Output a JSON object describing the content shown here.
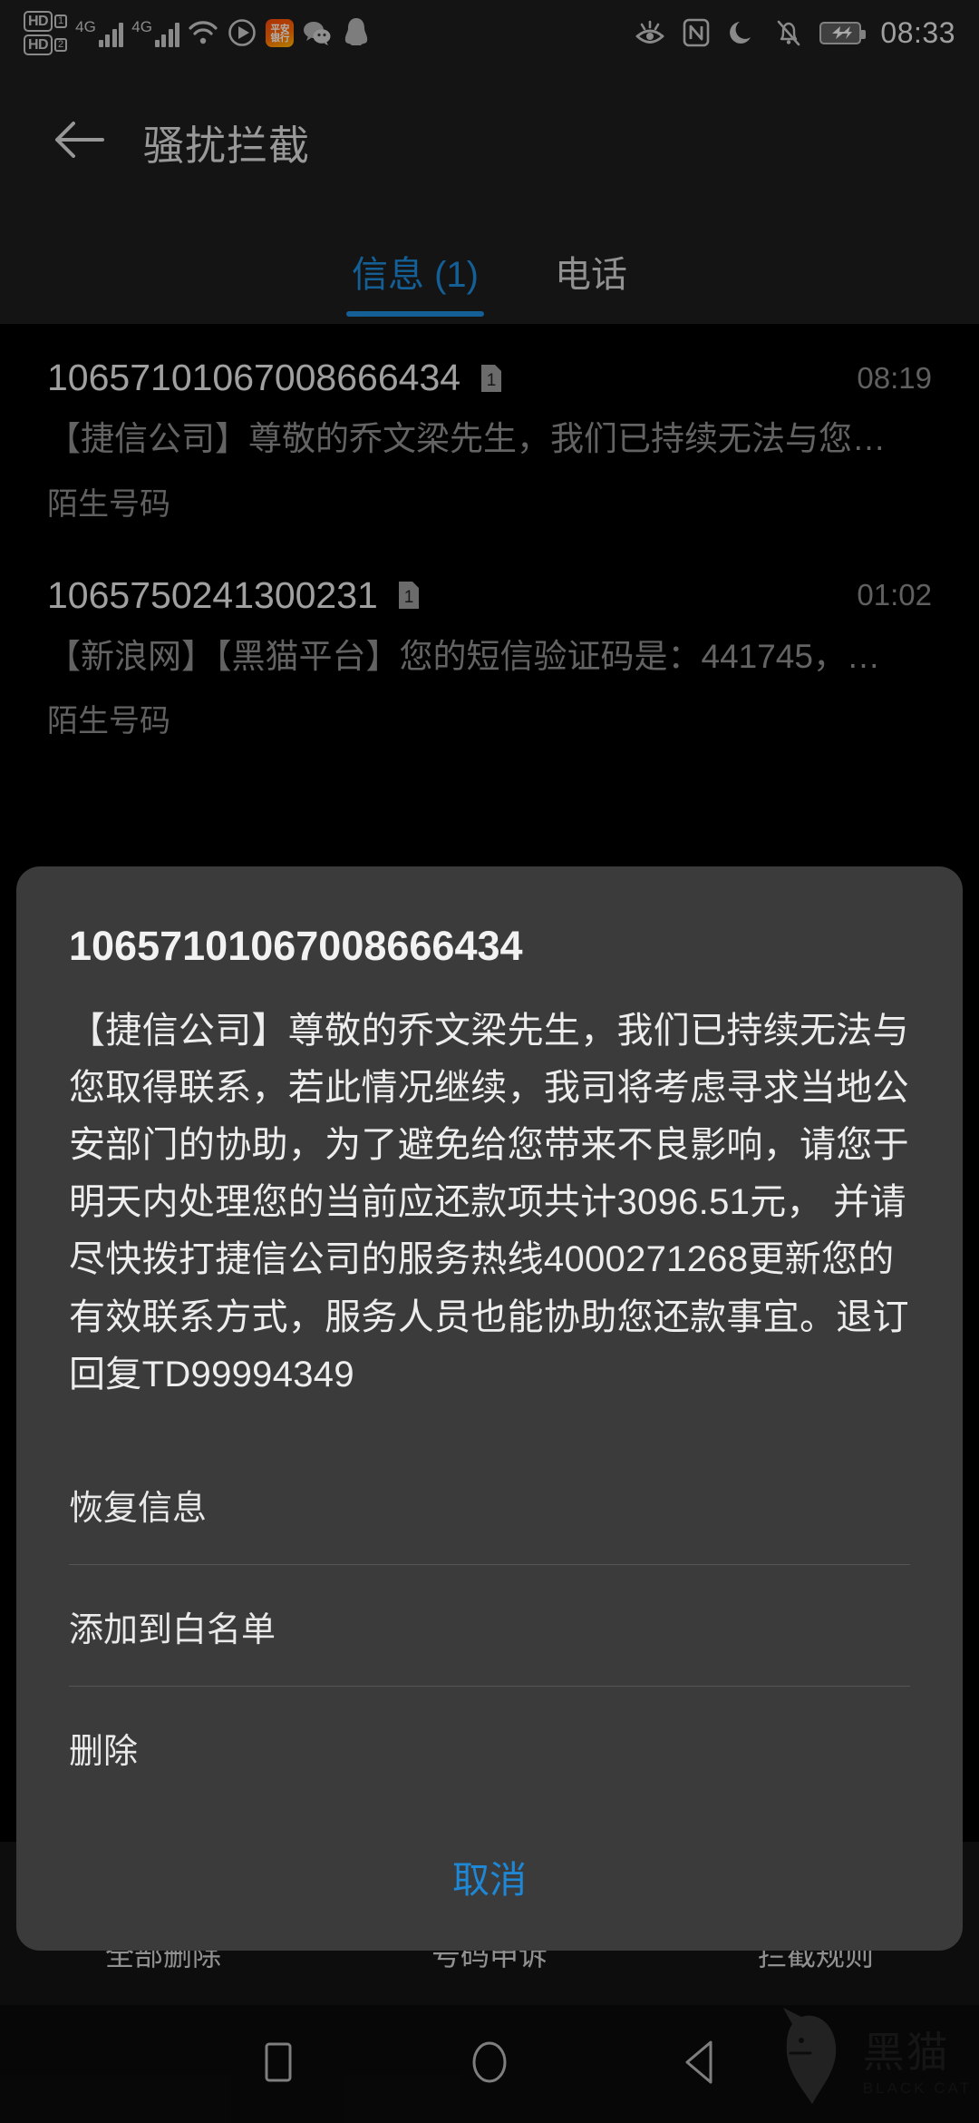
{
  "status_bar": {
    "hd_labels": [
      "HD",
      "HD"
    ],
    "sim_indexes": [
      "1",
      "2"
    ],
    "network_1": "4G",
    "network_2": "4G",
    "app_badge_line1": "平安",
    "app_badge_line2": "银行",
    "time": "08:33",
    "icons": [
      "hd-sim1-icon",
      "hd-sim2-icon",
      "signal-4g-sim1-icon",
      "signal-4g-sim2-icon",
      "wifi-icon",
      "media-play-icon",
      "pingan-bank-app-icon",
      "wechat-icon",
      "qq-icon",
      "eye-comfort-icon",
      "nfc-icon",
      "do-not-disturb-moon-icon",
      "silent-bell-icon",
      "battery-charging-icon"
    ]
  },
  "app_bar": {
    "back_icon": "back-arrow-icon",
    "title": "骚扰拦截"
  },
  "tabs": [
    {
      "label": "信息 (1)",
      "active": true
    },
    {
      "label": "电话",
      "active": false
    }
  ],
  "messages": [
    {
      "number": "10657101067008666434",
      "sim": "1",
      "time": "08:19",
      "preview": "【捷信公司】尊敬的乔文梁先生，我们已持续无法与您…",
      "tag": "陌生号码"
    },
    {
      "number": "1065750241300231",
      "sim": "1",
      "time": "01:02",
      "preview": "【新浪网】【黑猫平台】您的短信验证码是：441745，…",
      "tag": "陌生号码"
    }
  ],
  "dialog": {
    "title": "10657101067008666434",
    "body": "【捷信公司】尊敬的乔文梁先生，我们已持续无法与您取得联系，若此情况继续，我司将考虑寻求当地公安部门的协助，为了避免给您带来不良影响，请您于明天内处理您的当前应还款项共计3096.51元， 并请尽快拨打捷信公司的服务热线4000271268更新您的有效联系方式，服务人员也能协助您还款事宜。退订回复TD99994349",
    "actions": [
      {
        "label": "恢复信息",
        "name": "restore-message-action"
      },
      {
        "label": "添加到白名单",
        "name": "add-to-whitelist-action"
      },
      {
        "label": "删除",
        "name": "delete-action"
      }
    ],
    "cancel_label": "取消"
  },
  "toolbar": [
    {
      "label": "全部删除",
      "icon": "delete-all-icon"
    },
    {
      "label": "号码申诉",
      "icon": "number-appeal-icon"
    },
    {
      "label": "拦截规则",
      "icon": "block-rules-icon"
    }
  ],
  "nav_bar": {
    "recents": "recents-square-icon",
    "home": "home-circle-icon",
    "back": "back-triangle-icon"
  },
  "watermark": {
    "text": "黑猫",
    "sub": "BLACK CAT"
  },
  "colors": {
    "accent": "#1e88d6",
    "background": "#000000",
    "appbar": "#1d1d1d",
    "sheet": "#3b3b3b",
    "text_primary": "#ededed",
    "text_secondary": "#8e8e8e"
  }
}
